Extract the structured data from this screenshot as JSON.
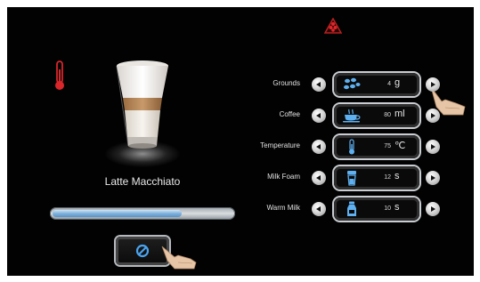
{
  "drink": {
    "name": "Latte Macchiato",
    "progress_fraction": 0.72
  },
  "icons": {
    "alert": "alert-triangle-icon",
    "temperature_warning": "thermometer-icon",
    "cancel": "cancel-icon"
  },
  "settings": [
    {
      "label": "Grounds",
      "value": "4",
      "unit": "g",
      "icon": "coffee-beans-icon"
    },
    {
      "label": "Coffee",
      "value": "80",
      "unit": "ml",
      "icon": "coffee-cup-icon"
    },
    {
      "label": "Temperature",
      "value": "75",
      "unit": "℃",
      "icon": "thermometer-icon"
    },
    {
      "label": "Milk Foam",
      "value": "12",
      "unit": "s",
      "icon": "milk-foam-cup-icon"
    },
    {
      "label": "Warm Milk",
      "value": "10",
      "unit": "s",
      "icon": "milk-bottle-icon"
    }
  ],
  "colors": {
    "background": "#020202",
    "accent_red": "#d8262b",
    "icon_blue": "#5fb0f0",
    "progress_fill": "#7fb1dc"
  }
}
